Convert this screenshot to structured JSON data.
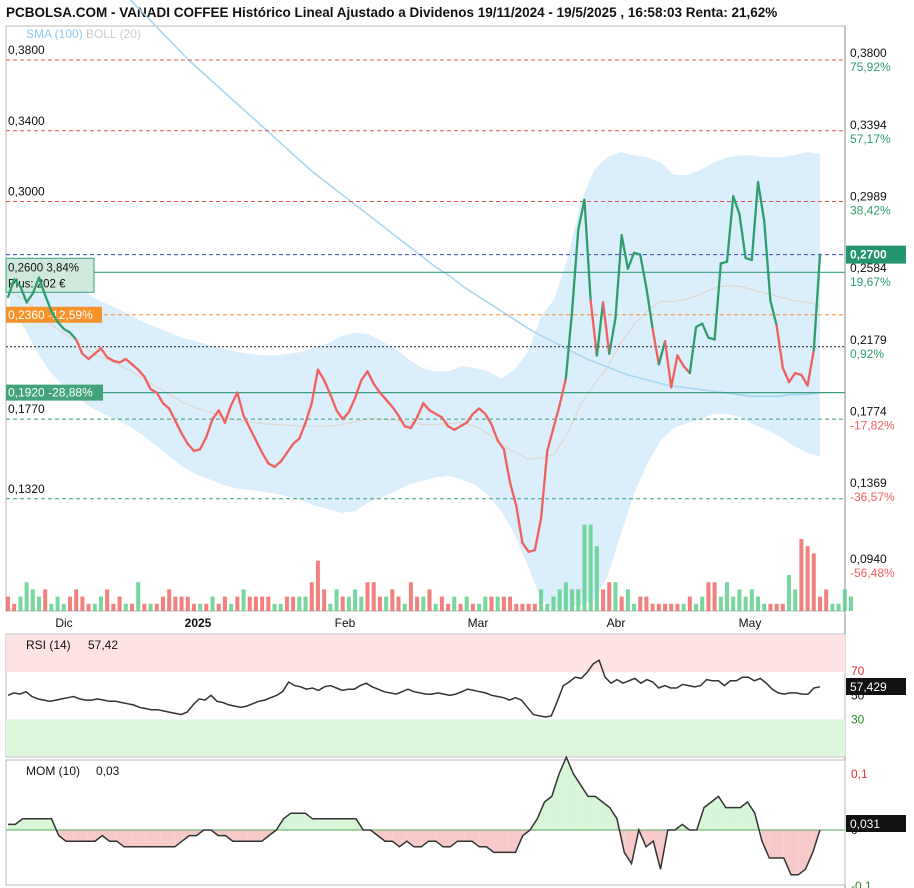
{
  "title": "PCBOLSA.COM - VANADI COFFEE Histórico Lineal Ajustado a Dividenos 19/11/2024 - 19/5/2025 , 16:58:03 Renta: 21,62%",
  "legend": {
    "sma": "SMA (100)",
    "boll": "BOLL (20)"
  },
  "colors": {
    "up": "#2e9e6e",
    "down": "#f0605e",
    "band": "#d6ecfb",
    "sma": "#a9d7f2",
    "orange": "#f5922a",
    "blue": "#3848c8",
    "gridRed": "#e05050",
    "gridGreen": "#3a9e70"
  },
  "left_levels": [
    {
      "label": "0,3800",
      "value": 0.38,
      "kind": "red"
    },
    {
      "label": "0,3400",
      "value": 0.34,
      "kind": "red"
    },
    {
      "label": "0,3000",
      "value": 0.3,
      "kind": "red"
    },
    {
      "label": "0,1770",
      "value": 0.177,
      "kind": "green"
    },
    {
      "label": "0,1320",
      "value": 0.132,
      "kind": "green"
    }
  ],
  "left_boxes": [
    {
      "line1": "0,2600  3,84%",
      "line2": "Plus: 202 €",
      "value": 0.26,
      "kind": "buy"
    },
    {
      "line1": "0,2360 -12,59%",
      "value": 0.236,
      "kind": "orange"
    },
    {
      "line1": "0,1920 -28,88%",
      "value": 0.192,
      "kind": "teal"
    }
  ],
  "right_levels": [
    {
      "price": "0,3800",
      "pct": "75,92%",
      "value": 0.38,
      "pct_color": "green"
    },
    {
      "price": "0,3394",
      "pct": "57,17%",
      "value": 0.3394,
      "pct_color": "green"
    },
    {
      "price": "0,2989",
      "pct": "38,42%",
      "value": 0.2989,
      "pct_color": "green"
    },
    {
      "price": "0,2584",
      "pct": "19,67%",
      "value": 0.2584,
      "pct_color": "green"
    },
    {
      "price": "0,2179",
      "pct": "0,92%",
      "value": 0.2179,
      "pct_color": "green"
    },
    {
      "price": "0,1774",
      "pct": "-17,82%",
      "value": 0.1774,
      "pct_color": "red"
    },
    {
      "price": "0,1369",
      "pct": "-36,57%",
      "value": 0.1369,
      "pct_color": "red"
    },
    {
      "price": "0,0940",
      "pct": "-56,48%",
      "value": 0.094,
      "pct_color": "red"
    }
  ],
  "current_price": "0,2700",
  "months": [
    "Dic",
    "2025",
    "Feb",
    "Mar",
    "Abr",
    "May"
  ],
  "rsi": {
    "label": "RSI (14)",
    "value": "57,42",
    "current": "57,429",
    "levels": [
      "70",
      "50",
      "30"
    ]
  },
  "mom": {
    "label": "MOM (10)",
    "value": "0,03",
    "current": "0,031",
    "levels": [
      "0,1",
      "0",
      "-0,1"
    ]
  },
  "chart_data": {
    "type": "line",
    "price": [
      0.246,
      0.256,
      0.252,
      0.243,
      0.248,
      0.257,
      0.247,
      0.238,
      0.232,
      0.228,
      0.226,
      0.222,
      0.214,
      0.211,
      0.214,
      0.217,
      0.212,
      0.21,
      0.209,
      0.211,
      0.208,
      0.205,
      0.201,
      0.194,
      0.192,
      0.186,
      0.183,
      0.176,
      0.169,
      0.163,
      0.159,
      0.16,
      0.167,
      0.177,
      0.182,
      0.175,
      0.185,
      0.192,
      0.179,
      0.172,
      0.165,
      0.158,
      0.152,
      0.15,
      0.153,
      0.158,
      0.163,
      0.166,
      0.175,
      0.186,
      0.205,
      0.199,
      0.191,
      0.182,
      0.177,
      0.181,
      0.189,
      0.199,
      0.204,
      0.197,
      0.192,
      0.188,
      0.184,
      0.179,
      0.173,
      0.172,
      0.178,
      0.186,
      0.182,
      0.18,
      0.178,
      0.173,
      0.171,
      0.173,
      0.175,
      0.18,
      0.183,
      0.18,
      0.174,
      0.165,
      0.16,
      0.141,
      0.128,
      0.107,
      0.102,
      0.103,
      0.121,
      0.159,
      0.172,
      0.185,
      0.2,
      0.238,
      0.284,
      0.301,
      0.244,
      0.213,
      0.243,
      0.214,
      0.234,
      0.281,
      0.262,
      0.271,
      0.27,
      0.251,
      0.228,
      0.208,
      0.221,
      0.195,
      0.213,
      0.207,
      0.203,
      0.229,
      0.231,
      0.223,
      0.222,
      0.265,
      0.266,
      0.303,
      0.293,
      0.268,
      0.267,
      0.311,
      0.289,
      0.244,
      0.23,
      0.206,
      0.198,
      0.203,
      0.202,
      0.196,
      0.216,
      0.27
    ],
    "volume": [
      2,
      1,
      2,
      4,
      3,
      2,
      3,
      1,
      2,
      1,
      2,
      3,
      2,
      1,
      1,
      2,
      3,
      1,
      2,
      1,
      1,
      4,
      1,
      1,
      1,
      2,
      3,
      2,
      2,
      2,
      1,
      1,
      1,
      2,
      1,
      2,
      1,
      2,
      3,
      2,
      2,
      2,
      2,
      1,
      1,
      2,
      2,
      2,
      2,
      4,
      7,
      3,
      1,
      3,
      2,
      2,
      3,
      2,
      4,
      4,
      2,
      2,
      3,
      2,
      1,
      4,
      2,
      2,
      3,
      1,
      2,
      1,
      2,
      1,
      2,
      1,
      1,
      2,
      2,
      2,
      2,
      2,
      1,
      1,
      1,
      1,
      3,
      1,
      2,
      3,
      4,
      3,
      3,
      12,
      12,
      9,
      3,
      4,
      4,
      2,
      3,
      1,
      2,
      2,
      1,
      1,
      1,
      1,
      1,
      1,
      2,
      1,
      2,
      4,
      4,
      2,
      4,
      2,
      3,
      2,
      3,
      2,
      1,
      1,
      1,
      1,
      5,
      3,
      10,
      9,
      8,
      2,
      3,
      1,
      1,
      3,
      2
    ],
    "volume_up": [
      2,
      3,
      4,
      5,
      7,
      8,
      9,
      14,
      15,
      19,
      21,
      23,
      31,
      33,
      36,
      38,
      43,
      44,
      47,
      48,
      52,
      53,
      55,
      56,
      57,
      61,
      64,
      67,
      69,
      72,
      74,
      76,
      77,
      79,
      86,
      87,
      88,
      89,
      90,
      91,
      92,
      93,
      94,
      95,
      98,
      100,
      101,
      109,
      111,
      112,
      115,
      116,
      117,
      118,
      119,
      120,
      121,
      122,
      126,
      127,
      133,
      134,
      135,
      136
    ],
    "sma100": [
      0.42,
      0.412,
      0.404,
      0.396,
      0.388,
      0.38,
      0.373,
      0.366,
      0.359,
      0.352,
      0.345,
      0.338,
      0.331,
      0.324,
      0.317,
      0.311,
      0.305,
      0.299,
      0.293,
      0.287,
      0.281,
      0.275,
      0.269,
      0.263,
      0.258,
      0.252,
      0.247,
      0.242,
      0.237,
      0.232,
      0.227,
      0.223,
      0.219,
      0.215,
      0.211,
      0.208,
      0.205,
      0.202,
      0.2,
      0.198,
      0.196,
      0.195,
      0.194,
      0.193,
      0.192,
      0.191,
      0.19,
      0.19,
      0.19,
      0.191,
      0.191,
      0.192
    ],
    "boll_upper": [
      0.258,
      0.26,
      0.262,
      0.258,
      0.256,
      0.252,
      0.247,
      0.243,
      0.24,
      0.236,
      0.232,
      0.229,
      0.226,
      0.223,
      0.221,
      0.219,
      0.217,
      0.215,
      0.214,
      0.213,
      0.213,
      0.214,
      0.215,
      0.218,
      0.22,
      0.224,
      0.226,
      0.225,
      0.221,
      0.217,
      0.211,
      0.206,
      0.204,
      0.204,
      0.207,
      0.206,
      0.204,
      0.2,
      0.205,
      0.215,
      0.235,
      0.245,
      0.268,
      0.3,
      0.318,
      0.325,
      0.328,
      0.326,
      0.325,
      0.322,
      0.315,
      0.315,
      0.318,
      0.322,
      0.325,
      0.326,
      0.326,
      0.325,
      0.325,
      0.326,
      0.328,
      0.327
    ],
    "boll_lower": [
      0.24,
      0.23,
      0.215,
      0.204,
      0.196,
      0.19,
      0.184,
      0.18,
      0.177,
      0.173,
      0.168,
      0.162,
      0.156,
      0.15,
      0.146,
      0.143,
      0.14,
      0.138,
      0.137,
      0.136,
      0.135,
      0.133,
      0.131,
      0.128,
      0.126,
      0.124,
      0.125,
      0.13,
      0.133,
      0.136,
      0.14,
      0.142,
      0.144,
      0.145,
      0.143,
      0.14,
      0.134,
      0.125,
      0.112,
      0.094,
      0.075,
      0.07,
      0.07,
      0.072,
      0.075,
      0.088,
      0.112,
      0.135,
      0.152,
      0.165,
      0.172,
      0.175,
      0.177,
      0.18,
      0.18,
      0.178,
      0.174,
      0.171,
      0.167,
      0.162,
      0.158,
      0.156
    ],
    "rsi_values": [
      50,
      52,
      51,
      53,
      49,
      47,
      46,
      45,
      46,
      47,
      48,
      49,
      47,
      46,
      46,
      47,
      46,
      45,
      45,
      44,
      43,
      42,
      40,
      39,
      38,
      38,
      37,
      36,
      35,
      34,
      36,
      42,
      47,
      46,
      50,
      45,
      44,
      42,
      41,
      40,
      41,
      43,
      45,
      46,
      48,
      50,
      53,
      61,
      58,
      57,
      55,
      56,
      54,
      57,
      58,
      56,
      54,
      55,
      55,
      58,
      60,
      57,
      55,
      53,
      52,
      51,
      53,
      55,
      53,
      52,
      51,
      51,
      52,
      51,
      50,
      51,
      53,
      55,
      54,
      53,
      52,
      50,
      49,
      48,
      46,
      48,
      46,
      40,
      34,
      33,
      32,
      33,
      45,
      58,
      61,
      65,
      64,
      69,
      76,
      79,
      65,
      60,
      63,
      60,
      62,
      64,
      60,
      63,
      61,
      56,
      58,
      56,
      56,
      59,
      58,
      57,
      58,
      63,
      62,
      62,
      58,
      62,
      62,
      65,
      65,
      62,
      64,
      60,
      55,
      52,
      51,
      52,
      52,
      51,
      51,
      56,
      57
    ],
    "mom_values": [
      0.01,
      0.01,
      0.02,
      0.02,
      0.02,
      0.02,
      0.02,
      -0.01,
      -0.02,
      -0.02,
      -0.02,
      -0.02,
      -0.02,
      -0.01,
      -0.02,
      -0.02,
      -0.03,
      -0.03,
      -0.03,
      -0.03,
      -0.03,
      -0.03,
      -0.03,
      -0.03,
      -0.02,
      -0.01,
      -0.01,
      0.0,
      0.0,
      -0.01,
      -0.01,
      -0.02,
      -0.02,
      -0.02,
      -0.02,
      -0.02,
      -0.01,
      0.0,
      0.02,
      0.03,
      0.03,
      0.03,
      0.02,
      0.02,
      0.02,
      0.02,
      0.02,
      0.02,
      0.02,
      0.0,
      0.0,
      -0.01,
      -0.02,
      -0.02,
      -0.03,
      -0.02,
      -0.03,
      -0.03,
      -0.02,
      -0.02,
      -0.03,
      -0.03,
      -0.02,
      -0.02,
      -0.02,
      -0.03,
      -0.03,
      -0.04,
      -0.04,
      -0.04,
      -0.04,
      -0.01,
      0.0,
      0.02,
      0.05,
      0.06,
      0.1,
      0.13,
      0.1,
      0.08,
      0.06,
      0.06,
      0.05,
      0.04,
      0.02,
      -0.04,
      -0.06,
      0.0,
      -0.03,
      -0.02,
      -0.07,
      0.0,
      0.0,
      0.01,
      0.0,
      0.0,
      0.04,
      0.05,
      0.06,
      0.04,
      0.04,
      0.04,
      0.05,
      0.03,
      -0.02,
      -0.05,
      -0.05,
      -0.05,
      -0.08,
      -0.08,
      -0.07,
      -0.04,
      0.0
    ],
    "ylim": [
      0.08,
      0.395
    ]
  }
}
